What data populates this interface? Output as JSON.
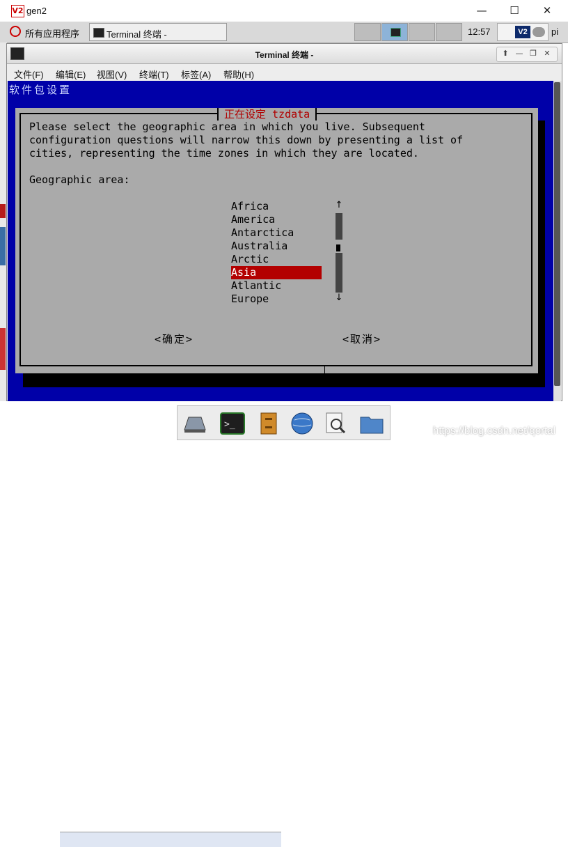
{
  "outer_window": {
    "title": "gen2",
    "logo_text": "V2",
    "controls": [
      "—",
      "☐",
      "✕"
    ]
  },
  "taskbar": {
    "apps_menu": "所有应用程序",
    "task_button": "Terminal 终端 -",
    "clock": "12:57",
    "tray_logo": "V2",
    "user": "pi"
  },
  "terminal": {
    "title": "Terminal 终端 -",
    "menu": [
      "文件(F)",
      "编辑(E)",
      "视图(V)",
      "终端(T)",
      "标签(A)",
      "帮助(H)"
    ],
    "backtitle": "软件包设置"
  },
  "dialog": {
    "title": "正在设定 tzdata",
    "lines": [
      "Please select the geographic area in which you live. Subsequent",
      "configuration questions will narrow this down by presenting a list of",
      "cities, representing the time zones in which they are located."
    ],
    "prompt": "Geographic area:",
    "options": [
      "Africa",
      "America",
      "Antarctica",
      "Australia",
      "Arctic",
      "Asia",
      "Atlantic",
      "Europe"
    ],
    "selected_index": 5,
    "ok_label": "<确定>",
    "cancel_label": "<取消>",
    "scroll_up": "↑",
    "scroll_down": "↓"
  },
  "watermark": "https://blog.csdn.net/qortal"
}
